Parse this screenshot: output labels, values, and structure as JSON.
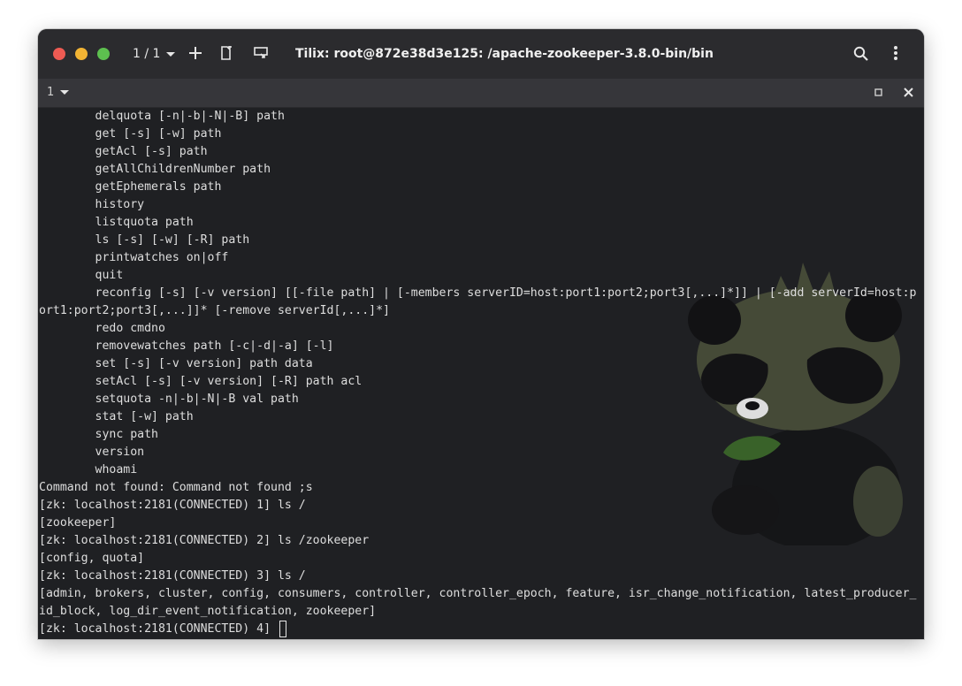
{
  "titlebar": {
    "session_counter": "1 / 1",
    "title": "Tilix: root@872e38d3e125: /apache-zookeeper-3.8.0-bin/bin"
  },
  "subbar": {
    "tab_label": "1"
  },
  "terminal": {
    "lines": [
      "        delquota [-n|-b|-N|-B] path",
      "        get [-s] [-w] path",
      "        getAcl [-s] path",
      "        getAllChildrenNumber path",
      "        getEphemerals path",
      "        history",
      "        listquota path",
      "        ls [-s] [-w] [-R] path",
      "        printwatches on|off",
      "        quit",
      "        reconfig [-s] [-v version] [[-file path] | [-members serverID=host:port1:port2;port3[,...]*]] | [-add serverId=host:p",
      "ort1:port2;port3[,...]]* [-remove serverId[,...]*]",
      "        redo cmdno",
      "        removewatches path [-c|-d|-a] [-l]",
      "        set [-s] [-v version] path data",
      "        setAcl [-s] [-v version] [-R] path acl",
      "        setquota -n|-b|-N|-B val path",
      "        stat [-w] path",
      "        sync path",
      "        version",
      "        whoami",
      "Command not found: Command not found ;s",
      "[zk: localhost:2181(CONNECTED) 1] ls /",
      "[zookeeper]",
      "[zk: localhost:2181(CONNECTED) 2] ls /zookeeper",
      "[config, quota]",
      "[zk: localhost:2181(CONNECTED) 3] ls /",
      "[admin, brokers, cluster, config, consumers, controller, controller_epoch, feature, isr_change_notification, latest_producer_",
      "id_block, log_dir_event_notification, zookeeper]"
    ],
    "prompt": "[zk: localhost:2181(CONNECTED) 4] "
  },
  "icons": {
    "session_dropdown": "chevron-down-icon",
    "add_terminal": "plus-icon",
    "new_session": "add-session-icon",
    "sync_input": "sync-input-icon",
    "search": "search-icon",
    "menu": "kebab-menu-icon",
    "tab_dropdown": "chevron-down-icon",
    "maximize": "maximize-icon",
    "close": "close-icon"
  },
  "colors": {
    "red": "#ee5b53",
    "yellow": "#f2b434",
    "green": "#5dc04f",
    "terminal_bg": "#1f2023",
    "text": "#dedede"
  }
}
